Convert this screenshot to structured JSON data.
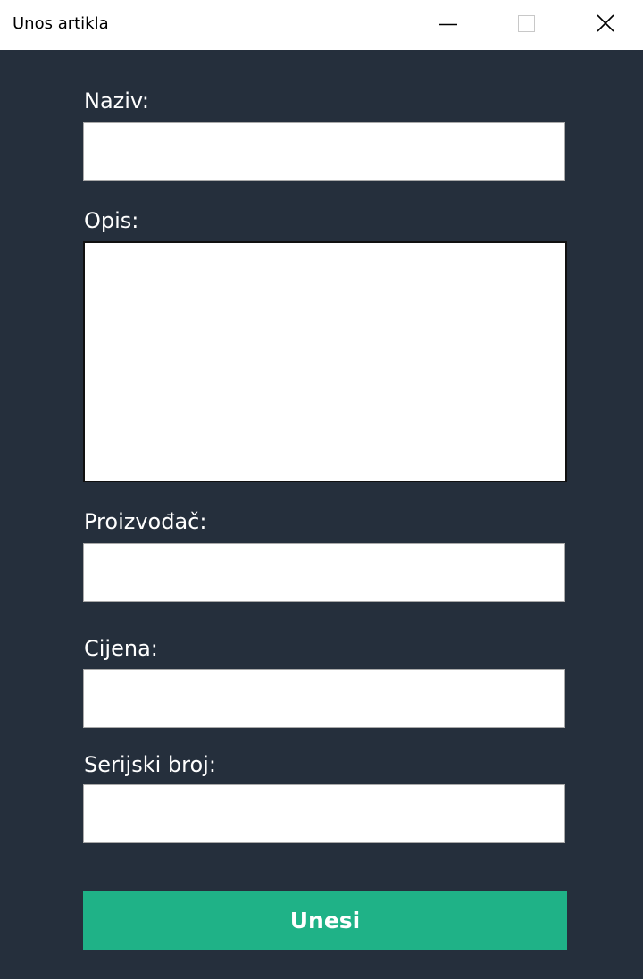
{
  "window": {
    "title": "Unos artikla"
  },
  "form": {
    "naziv": {
      "label": "Naziv:",
      "value": ""
    },
    "opis": {
      "label": "Opis:",
      "value": ""
    },
    "proizvodac": {
      "label": "Proizvođač:",
      "value": ""
    },
    "cijena": {
      "label": "Cijena:",
      "value": ""
    },
    "serijski_broj": {
      "label": "Serijski broj:",
      "value": ""
    },
    "submit_label": "Unesi"
  },
  "colors": {
    "background": "#252f3c",
    "button": "#1fb287",
    "label_text": "#ffffff"
  },
  "icons": {
    "minimize": "minimize-icon",
    "maximize": "maximize-icon",
    "close": "close-icon"
  }
}
